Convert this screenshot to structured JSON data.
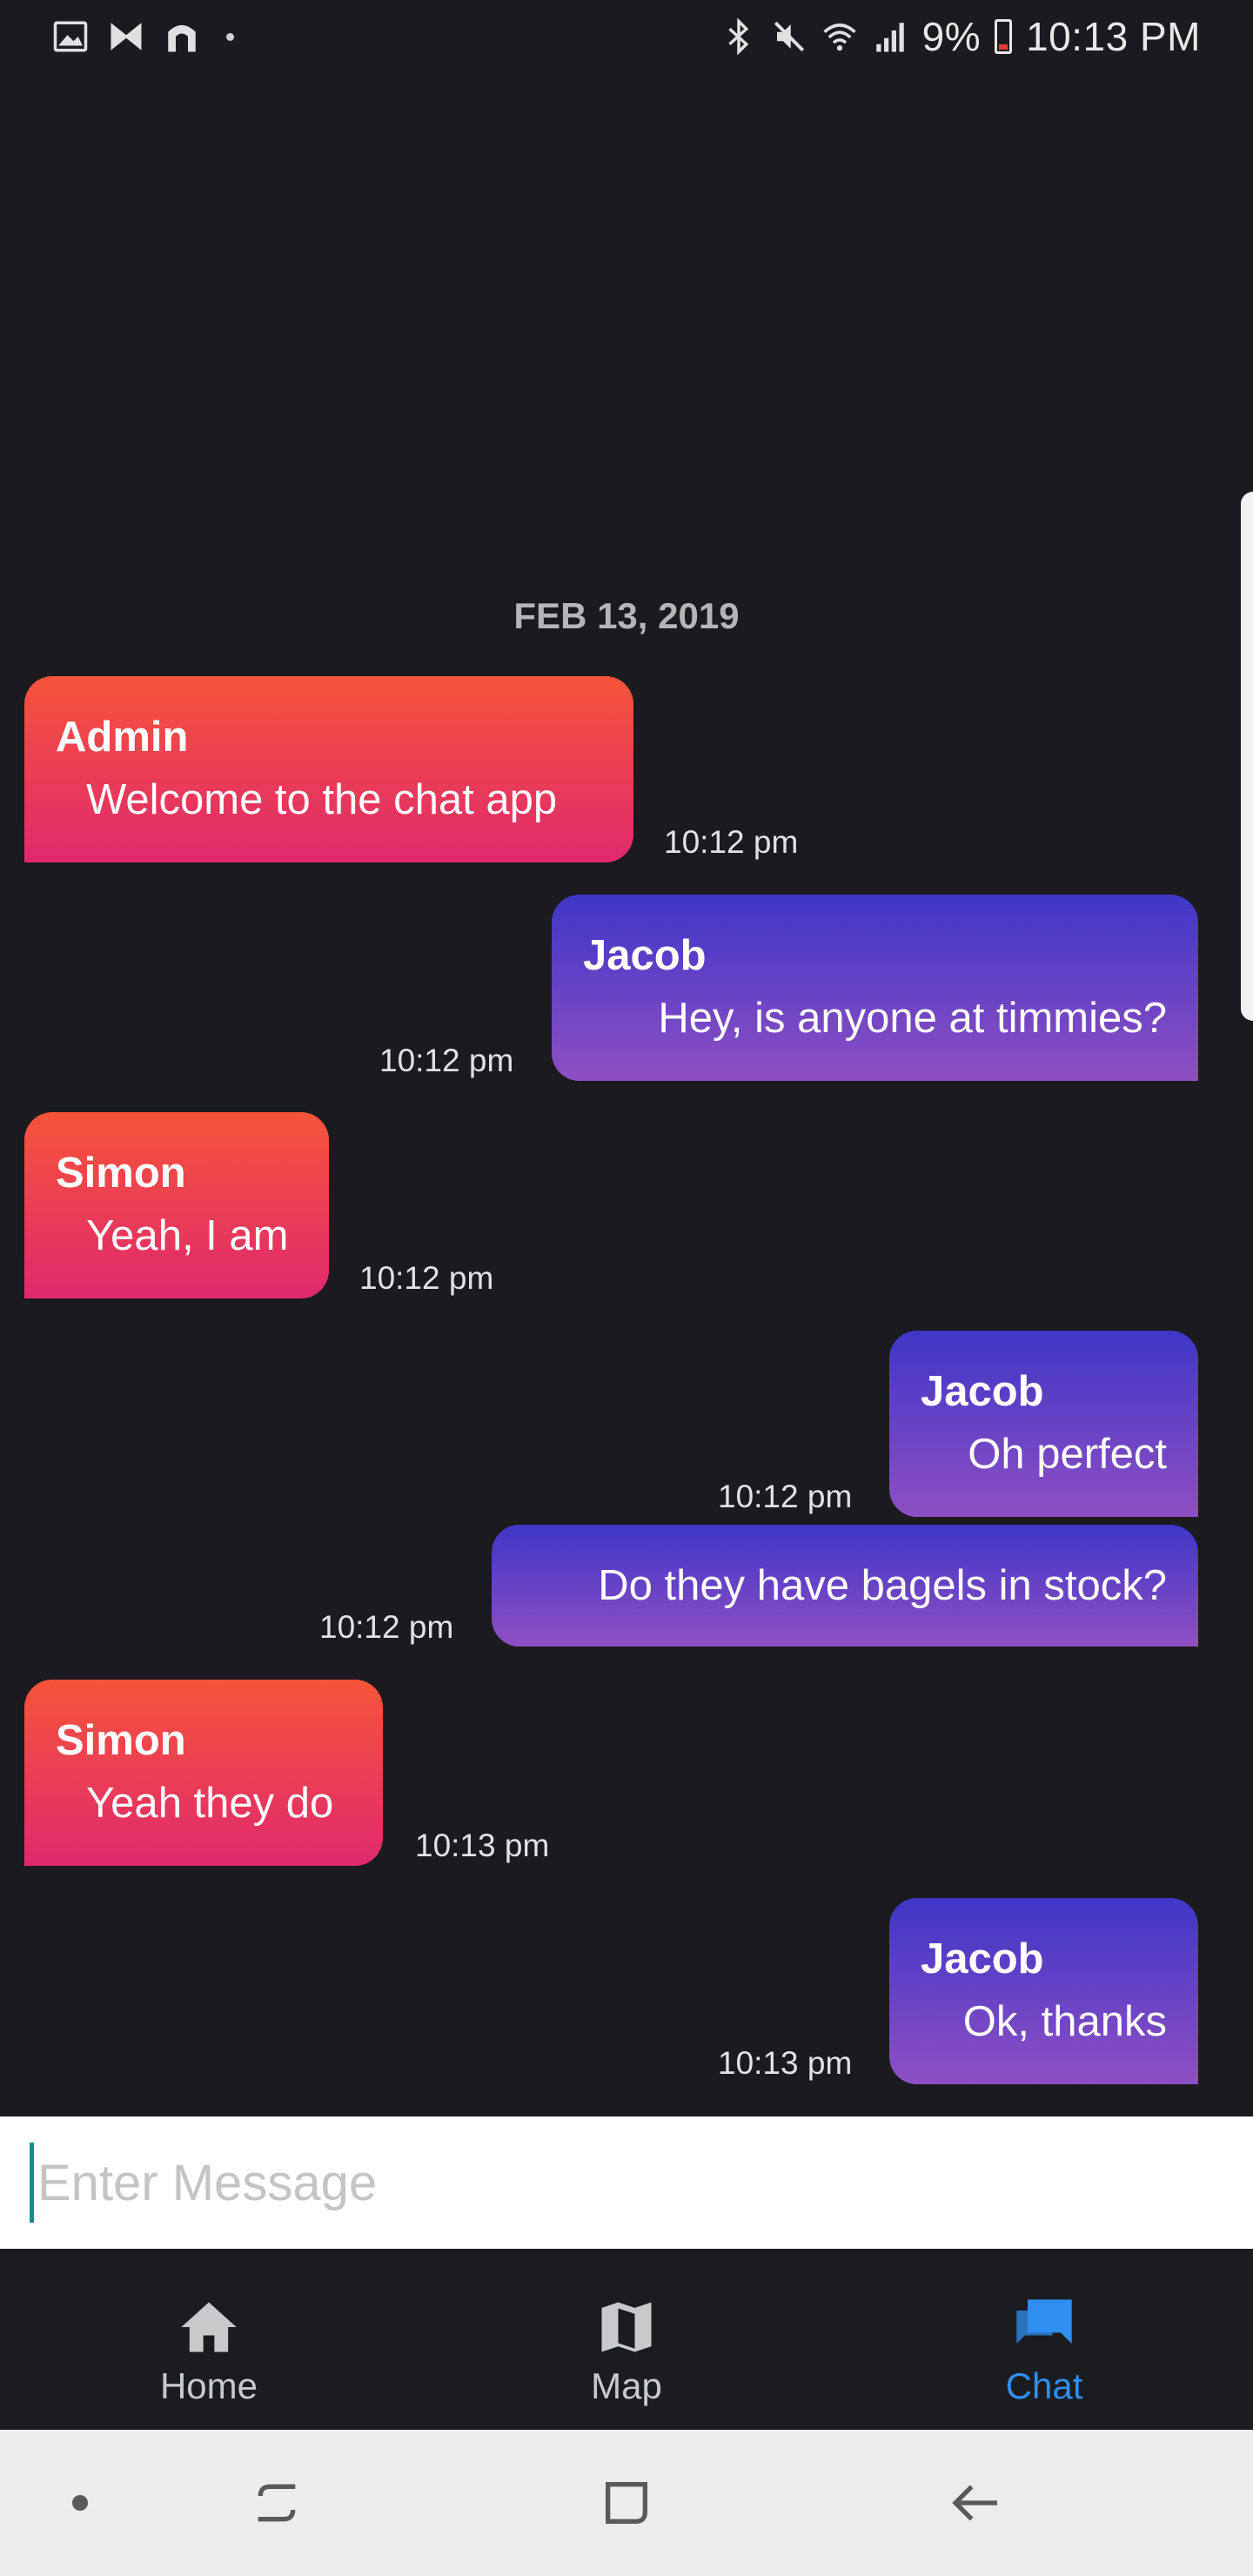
{
  "status_bar": {
    "battery_percent": "9%",
    "time": "10:13 PM",
    "left_icons": [
      "gallery-icon",
      "bowtie-app-icon",
      "tunnel-app-icon",
      "notification-dot"
    ],
    "right_icons": [
      "bluetooth-icon",
      "mute-icon",
      "wifi-icon",
      "signal-icon",
      "battery-icon"
    ]
  },
  "chat": {
    "date": "FEB 13, 2019",
    "messages": [
      {
        "direction": "in",
        "sender": "Admin",
        "text": "Welcome to the chat app",
        "time": "10:12 pm"
      },
      {
        "direction": "out",
        "sender": "Jacob",
        "text": "Hey, is anyone at timmies?",
        "time": "10:12 pm"
      },
      {
        "direction": "in",
        "sender": "Simon",
        "text": "Yeah, I am",
        "time": "10:12 pm"
      },
      {
        "direction": "out",
        "sender": "Jacob",
        "text": "Oh perfect",
        "time": "10:12 pm"
      },
      {
        "direction": "out",
        "sender": "",
        "text": "Do they have bagels in stock?",
        "time": "10:12 pm"
      },
      {
        "direction": "in",
        "sender": "Simon",
        "text": "Yeah they do",
        "time": "10:13 pm"
      },
      {
        "direction": "out",
        "sender": "Jacob",
        "text": "Ok, thanks",
        "time": "10:13 pm"
      }
    ]
  },
  "composer": {
    "placeholder": "Enter Message",
    "value": ""
  },
  "bottom_nav": {
    "items": [
      {
        "label": "Home",
        "icon": "home-icon",
        "active": false
      },
      {
        "label": "Map",
        "icon": "map-icon",
        "active": false
      },
      {
        "label": "Chat",
        "icon": "chat-icon",
        "active": true
      }
    ]
  },
  "system_nav": {
    "buttons": [
      "dot-button",
      "recent-apps-button",
      "home-button",
      "back-button"
    ]
  },
  "colors": {
    "background": "#1a1a1f",
    "incoming_gradient": [
      "#f6543a",
      "#e0296d"
    ],
    "outgoing_gradient": [
      "#3f36c7",
      "#8e4fc3"
    ],
    "active_nav": "#2f8ff0",
    "cursor": "#0f8f8c"
  }
}
